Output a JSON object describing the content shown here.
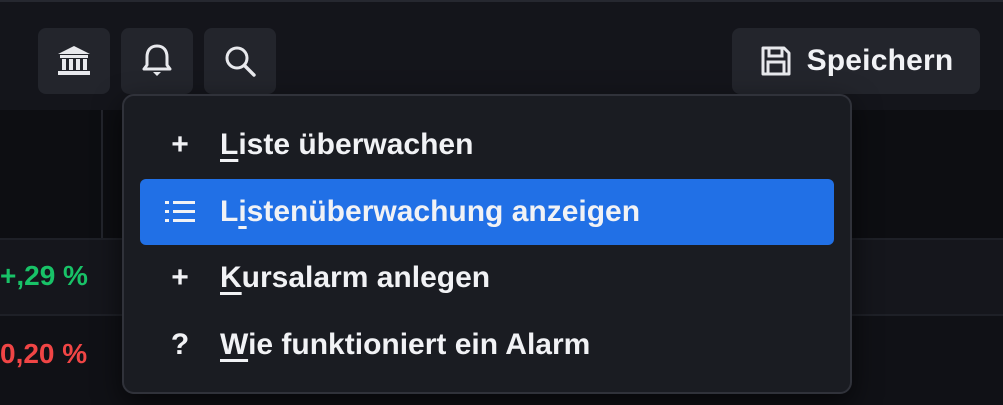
{
  "toolbar": {
    "buttons": [
      {
        "icon": "bank-icon"
      },
      {
        "icon": "bell-icon"
      },
      {
        "icon": "search-icon"
      }
    ],
    "save_label": "Speichern",
    "save_icon": "floppy-disk-icon"
  },
  "table": {
    "rows": [
      {
        "value": "+,29 %",
        "sign": "positive"
      },
      {
        "value": "0,20 %",
        "sign": "negative"
      }
    ]
  },
  "menu": {
    "items": [
      {
        "icon": "+",
        "mnemonic": "L",
        "rest": "iste überwachen",
        "active": false
      },
      {
        "icon": "list-icon",
        "mnemonic": "i",
        "pre": "L",
        "rest": "stenüberwachung anzeigen",
        "active": true
      },
      {
        "icon": "+",
        "mnemonic": "K",
        "rest": "ursalarm anlegen",
        "active": false
      },
      {
        "icon": "?",
        "mnemonic": "W",
        "rest": "ie funktioniert ein Alarm",
        "active": false
      }
    ]
  },
  "colors": {
    "accent": "#2170e6",
    "positive": "#18c267",
    "negative": "#f04545"
  }
}
